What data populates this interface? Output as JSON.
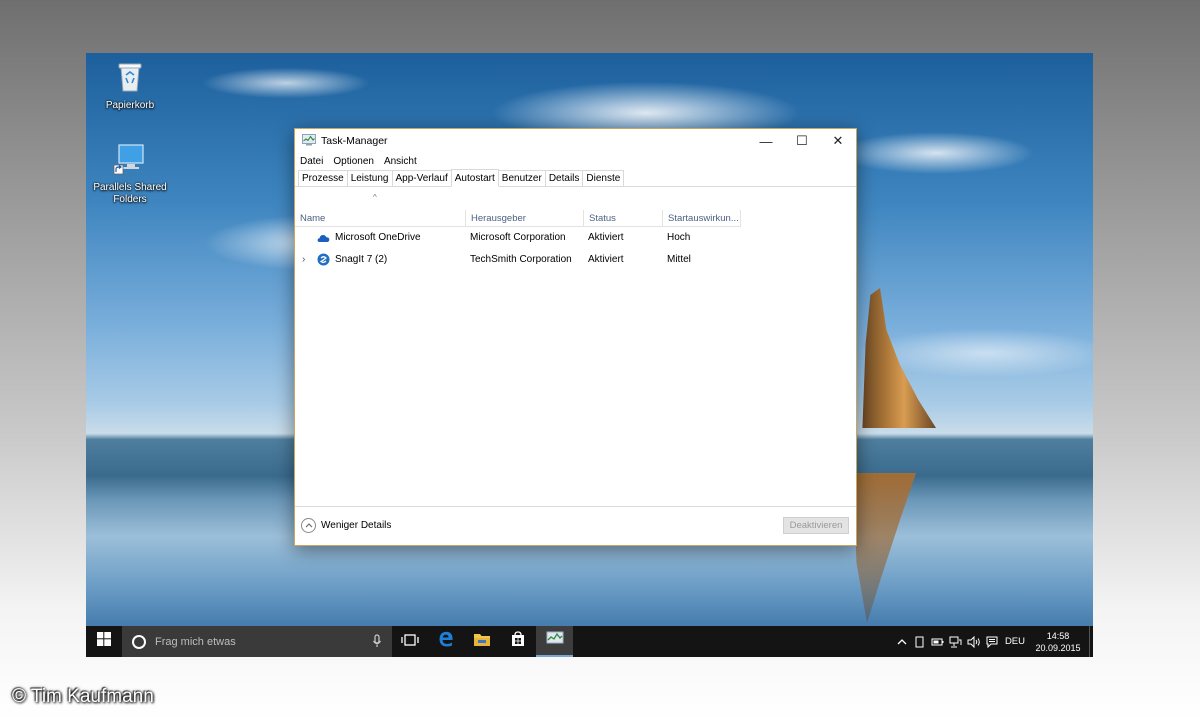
{
  "desktop": {
    "icons": [
      {
        "label": "Papierkorb",
        "icon": "recycle-bin-icon"
      },
      {
        "label": "Parallels Shared Folders",
        "icon": "monitor-shortcut-icon"
      }
    ]
  },
  "window": {
    "title": "Task-Manager",
    "controls": {
      "minimize": "—",
      "maximize": "☐",
      "close": "✕"
    },
    "menu": [
      "Datei",
      "Optionen",
      "Ansicht"
    ],
    "tabs": [
      "Prozesse",
      "Leistung",
      "App-Verlauf",
      "Autostart",
      "Benutzer",
      "Details",
      "Dienste"
    ],
    "active_tab": "Autostart",
    "table": {
      "sort_indicator": "^",
      "columns": [
        "Name",
        "Herausgeber",
        "Status",
        "Startauswirkun..."
      ],
      "rows": [
        {
          "expand": "",
          "icon": "onedrive-cloud-icon",
          "name": "Microsoft OneDrive",
          "publisher": "Microsoft Corporation",
          "status": "Aktiviert",
          "impact": "Hoch"
        },
        {
          "expand": "›",
          "icon": "snagit-icon",
          "name": "SnagIt 7 (2)",
          "publisher": "TechSmith Corporation",
          "status": "Aktiviert",
          "impact": "Mittel"
        }
      ]
    },
    "footer": {
      "less_details": "Weniger Details",
      "deactivate": "Deaktivieren"
    }
  },
  "taskbar": {
    "search_placeholder": "Frag mich etwas",
    "tray_language": "DEU",
    "clock_time": "14:58",
    "clock_date": "20.09.2015"
  },
  "credit": "© Tim Kaufmann",
  "colors": {
    "window_border": "#c9a560",
    "column_header_text": "#4d6082",
    "taskbar_bg": "#141414",
    "edge_blue": "#1e7fd6"
  }
}
